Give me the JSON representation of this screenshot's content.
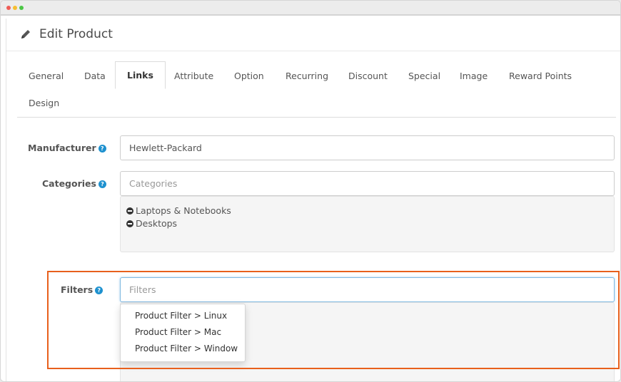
{
  "window": {
    "controls": [
      "close",
      "minimize",
      "maximize"
    ]
  },
  "heading": {
    "icon": "pencil-icon",
    "title": "Edit Product"
  },
  "tabs": [
    {
      "label": "General"
    },
    {
      "label": "Data"
    },
    {
      "label": "Links",
      "active": true
    },
    {
      "label": "Attribute"
    },
    {
      "label": "Option"
    },
    {
      "label": "Recurring"
    },
    {
      "label": "Discount"
    },
    {
      "label": "Special"
    },
    {
      "label": "Image"
    },
    {
      "label": "Reward Points"
    },
    {
      "label": "Design"
    }
  ],
  "form": {
    "manufacturer": {
      "label": "Manufacturer",
      "value": "Hewlett-Packard"
    },
    "categories": {
      "label": "Categories",
      "placeholder": "Categories",
      "selected": [
        "Laptops & Notebooks",
        "Desktops"
      ]
    },
    "filters": {
      "label": "Filters",
      "placeholder": "Filters",
      "suggestions": [
        "Product Filter > Linux",
        "Product Filter > Mac",
        "Product Filter > Window"
      ]
    }
  },
  "colors": {
    "accent": "#1e91cf",
    "highlight": "#e8601c"
  }
}
